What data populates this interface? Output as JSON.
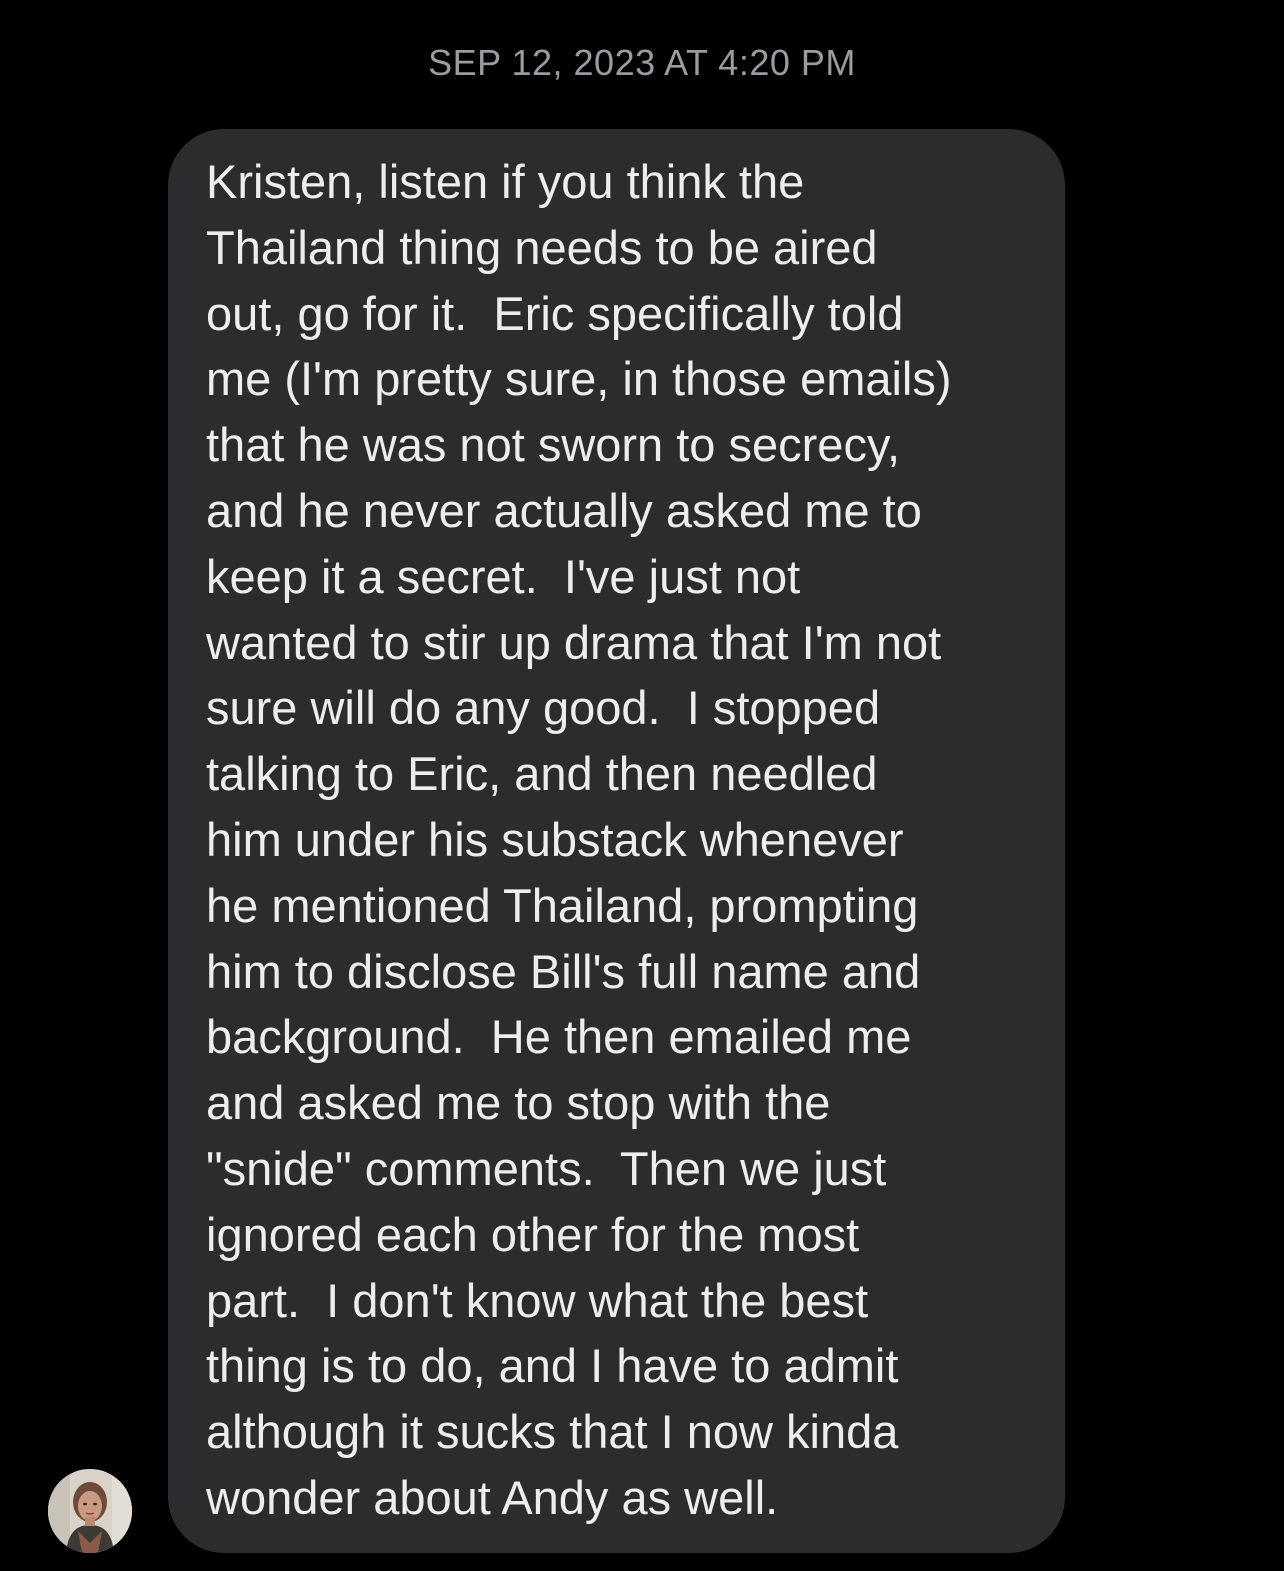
{
  "conversation": {
    "timestamp": "SEP 12, 2023 AT 4:20 PM",
    "message": {
      "lines": [
        "Kristen, listen if you think the",
        "Thailand thing needs to be aired",
        "out, go for it.  Eric specifically told",
        "me (I'm pretty sure, in those emails)",
        "that he was not sworn to secrecy,",
        "and he never actually asked me to",
        "keep it a secret.  I've just not",
        "wanted to stir up drama that I'm not",
        "sure will do any good.  I stopped",
        "talking to Eric, and then needled",
        "him under his substack whenever",
        "he mentioned Thailand, prompting",
        "him to disclose Bill's full name and",
        "background.  He then emailed me",
        "and asked me to stop with the",
        "\"snide\" comments.  Then we just",
        "ignored each other for the most",
        "part.  I don't know what the best",
        "thing is to do, and I have to admit",
        "although it sucks that I now kinda",
        "wonder about Andy as well."
      ]
    },
    "sender_avatar_icon": "person-photo"
  },
  "colors": {
    "background": "#000000",
    "bubble": "#2c2c2e",
    "message_text": "#ededf0",
    "timestamp_text": "#9b9ba0"
  }
}
